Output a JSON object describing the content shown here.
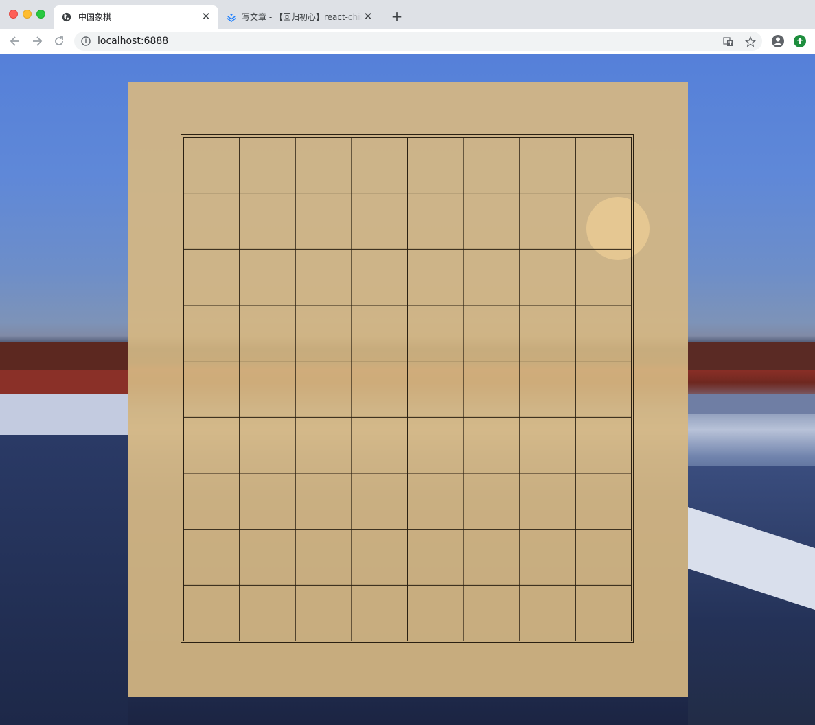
{
  "browser": {
    "tabs": [
      {
        "title": "中国象棋",
        "active": true,
        "icon": "globe-icon"
      },
      {
        "title": "写文章 - 【回归初心】react-chinese-chess",
        "active": false,
        "icon": "juejin-icon"
      }
    ],
    "close_glyph": "✕",
    "new_tab_glyph": "+",
    "address": "localhost:6888"
  },
  "board": {
    "columns": 8,
    "rows": 9,
    "line_color": "#2a2012",
    "panel_color": "#d6b782"
  }
}
